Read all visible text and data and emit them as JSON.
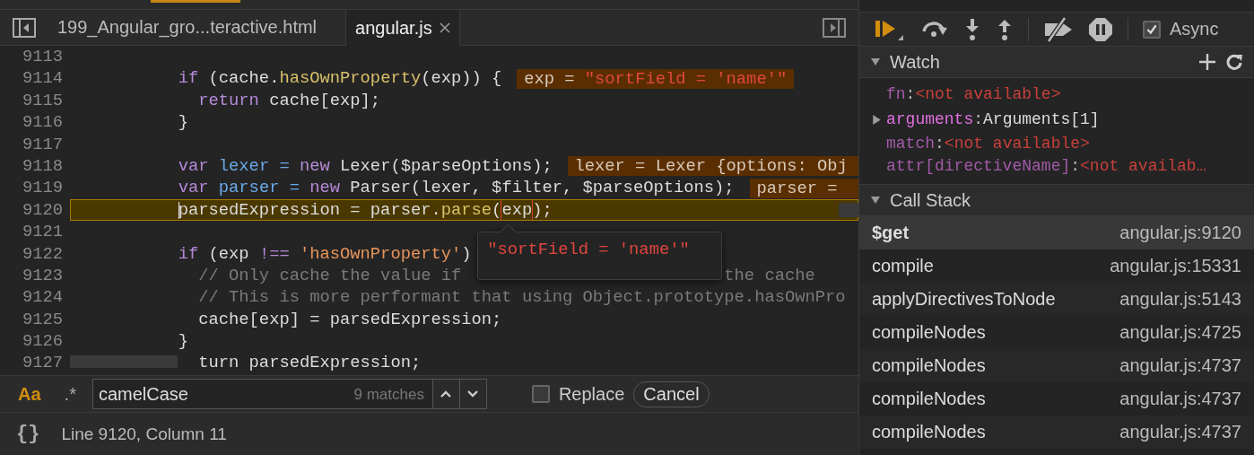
{
  "editor": {
    "tabs": [
      {
        "label": "199_Angular_gro...teractive.html",
        "selected": false,
        "closable": false
      },
      {
        "label": "angular.js",
        "selected": true,
        "closable": true
      }
    ],
    "lines": [
      {
        "number": "9113",
        "current": false
      },
      {
        "number": "9114",
        "current": false,
        "tokens": [
          {
            "kind": "keyword",
            "text": "if"
          },
          {
            "kind": "plain",
            "text": " (cache."
          },
          {
            "kind": "method",
            "text": "hasOwnProperty"
          },
          {
            "kind": "plain",
            "text": "(exp)) {"
          }
        ],
        "inline_value": [
          {
            "kind": "name",
            "text": "exp = "
          },
          {
            "kind": "string",
            "text": "\"sortField = 'name'\""
          }
        ]
      },
      {
        "number": "9115",
        "current": false,
        "tokens": [
          {
            "kind": "keyword",
            "text": "  return"
          },
          {
            "kind": "plain",
            "text": " cache[exp];"
          }
        ]
      },
      {
        "number": "9116",
        "current": false,
        "tokens": [
          {
            "kind": "plain",
            "text": "}"
          }
        ]
      },
      {
        "number": "9117",
        "current": false
      },
      {
        "number": "9118",
        "current": false,
        "tokens": [
          {
            "kind": "keyword",
            "text": "var "
          },
          {
            "kind": "def",
            "text": "lexer = "
          },
          {
            "kind": "keyword",
            "text": "new"
          },
          {
            "kind": "plain",
            "text": " Lexer($parseOptions);"
          }
        ],
        "inline_value": [
          {
            "kind": "name",
            "text": "lexer = Lexer {options: Obj"
          }
        ]
      },
      {
        "number": "9119",
        "current": false,
        "tokens": [
          {
            "kind": "keyword",
            "text": "var "
          },
          {
            "kind": "def",
            "text": "parser = "
          },
          {
            "kind": "keyword",
            "text": "new"
          },
          {
            "kind": "plain",
            "text": " Parser(lexer, $filter, $parseOptions);"
          }
        ],
        "inline_value": [
          {
            "kind": "name",
            "text": "parser = "
          }
        ]
      },
      {
        "number": "9120",
        "current": true,
        "tokens": [
          {
            "kind": "plain",
            "text": "parsedExpression = parser."
          },
          {
            "kind": "method",
            "text": "parse"
          },
          {
            "kind": "plain",
            "text": "("
          },
          {
            "kind": "hover",
            "text": "exp"
          },
          {
            "kind": "plain",
            "text": ");"
          }
        ]
      },
      {
        "number": "9121",
        "current": false
      },
      {
        "number": "9122",
        "current": false,
        "tokens": [
          {
            "kind": "keyword",
            "text": "if"
          },
          {
            "kind": "plain",
            "text": " (exp "
          },
          {
            "kind": "keyword",
            "text": "!=="
          },
          {
            "kind": "string",
            "text": " 'hasOwnProperty'"
          },
          {
            "kind": "plain",
            "text": ")"
          }
        ]
      },
      {
        "number": "9123",
        "current": false,
        "tokens": [
          {
            "kind": "comment",
            "text": "  // Only cache the value if"
          },
          {
            "kind": "comment",
            "text": "                          the cache"
          }
        ]
      },
      {
        "number": "9124",
        "current": false,
        "tokens": [
          {
            "kind": "comment",
            "text": "  // This is more performant that using Object.prototype.hasOwnPro"
          }
        ]
      },
      {
        "number": "9125",
        "current": false,
        "tokens": [
          {
            "kind": "plain",
            "text": "  cache[exp] = parsedExpression;"
          }
        ]
      },
      {
        "number": "9126",
        "current": false,
        "tokens": [
          {
            "kind": "plain",
            "text": "}"
          }
        ]
      },
      {
        "number": "9127",
        "current": false,
        "tokens": [
          {
            "kind": "plain",
            "text": "  turn parsedExpression;"
          }
        ]
      }
    ],
    "hover_tooltip": {
      "value": "\"sortField = 'name'\""
    },
    "search": {
      "case_label": "Aa",
      "case_sensitive": true,
      "regex_label": ".*",
      "regex": false,
      "value": "camelCase",
      "matches": "9 matches",
      "replace_label": "Replace",
      "replace": false,
      "cancel": "Cancel"
    },
    "status_bar": {
      "format_label": "{}",
      "position": "Line 9120, Column 11"
    }
  },
  "debugger": {
    "async": {
      "label": "Async",
      "checked": true
    },
    "watch": {
      "title": "Watch",
      "expanded": true,
      "items": [
        {
          "name": "fn",
          "separator": ":",
          "value": "<not available>",
          "kind": "unavailable",
          "expandable": false
        },
        {
          "name": "arguments",
          "separator": ":",
          "value": "Arguments[1]",
          "kind": "object",
          "expandable": true
        },
        {
          "name": "match",
          "separator": ":",
          "value": "<not available>",
          "kind": "unavailable",
          "expandable": false
        },
        {
          "name": "attr[directiveName]",
          "separator": ":",
          "value": "<not availab…",
          "kind": "unavailable",
          "expandable": false
        }
      ]
    },
    "call_stack": {
      "title": "Call Stack",
      "expanded": true,
      "frames": [
        {
          "name": "$get",
          "location": "angular.js:9120",
          "selected": true
        },
        {
          "name": "compile",
          "location": "angular.js:15331",
          "selected": false
        },
        {
          "name": "applyDirectivesToNode",
          "location": "angular.js:5143",
          "selected": false
        },
        {
          "name": "compileNodes",
          "location": "angular.js:4725",
          "selected": false
        },
        {
          "name": "compileNodes",
          "location": "angular.js:4737",
          "selected": false
        },
        {
          "name": "compileNodes",
          "location": "angular.js:4737",
          "selected": false
        },
        {
          "name": "compileNodes",
          "location": "angular.js:4737",
          "selected": false
        }
      ]
    }
  }
}
